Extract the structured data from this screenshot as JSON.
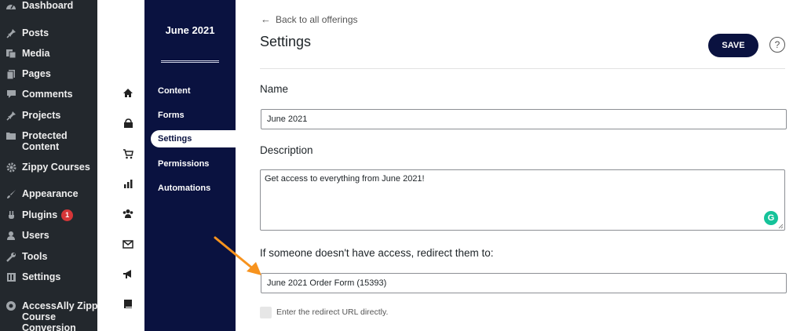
{
  "wp_menu": {
    "items": [
      {
        "label": "Dashboard",
        "icon": "dashboard-icon"
      },
      {
        "label": "Posts",
        "icon": "pin-icon"
      },
      {
        "label": "Media",
        "icon": "media-icon"
      },
      {
        "label": "Pages",
        "icon": "pages-icon"
      },
      {
        "label": "Comments",
        "icon": "comment-icon"
      },
      {
        "label": "Projects",
        "icon": "pin-icon"
      },
      {
        "label": "Protected",
        "label2": "Content",
        "icon": "folder-icon"
      },
      {
        "label": "Zippy Courses",
        "icon": "gear-icon"
      },
      {
        "label": "Appearance",
        "icon": "brush-icon"
      },
      {
        "label": "Plugins",
        "badge": "1",
        "icon": "plug-icon"
      },
      {
        "label": "Users",
        "icon": "user-icon"
      },
      {
        "label": "Tools",
        "icon": "wrench-icon"
      },
      {
        "label": "Settings",
        "icon": "settings-icon"
      },
      {
        "label": "AccessAlly Zippy",
        "label2": "Course",
        "label3": "Conversion",
        "icon": "accessally-icon"
      }
    ]
  },
  "icon_rail": [
    "home-icon",
    "store-icon",
    "cart-icon",
    "bar-chart-icon",
    "users-group-icon",
    "envelope-icon",
    "megaphone-icon",
    "book-icon"
  ],
  "offering": {
    "title": "June 2021",
    "nav": [
      {
        "label": "Content"
      },
      {
        "label": "Forms"
      },
      {
        "label": "Settings"
      },
      {
        "label": "Permissions"
      },
      {
        "label": "Automations"
      }
    ]
  },
  "main": {
    "back_link": "Back to all offerings",
    "title": "Settings",
    "save_label": "SAVE",
    "help_label": "?",
    "name_label": "Name",
    "name_value": "June 2021",
    "description_label": "Description",
    "description_value": "Get access to everything from June 2021!",
    "redirect_label": "If someone doesn't have access, redirect them to:",
    "redirect_value": "June 2021 Order Form (15393)",
    "direct_url_label": "Enter the redirect URL directly."
  },
  "colors": {
    "wp_sidebar": "#23282d",
    "offering_nav": "#0a1240",
    "save_button": "#0a1240",
    "annotation_arrow": "#f7931e",
    "grammarly": "#15c39a"
  }
}
